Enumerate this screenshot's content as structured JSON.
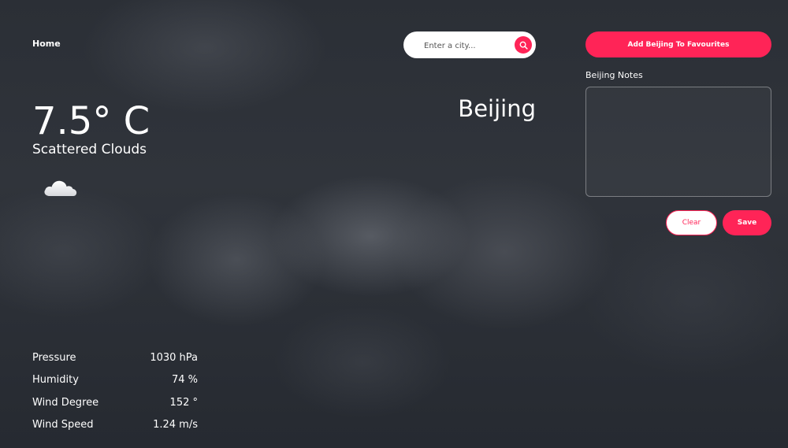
{
  "nav": {
    "home_label": "Home"
  },
  "search": {
    "placeholder": "Enter a city...",
    "value": "",
    "button_icon": "search-icon"
  },
  "city": {
    "name": "Beijing"
  },
  "weather": {
    "temperature": "7.5° C",
    "description": "Scattered Clouds",
    "icon": "cloud-icon"
  },
  "stats": [
    {
      "label": "Pressure",
      "value": "1030 hPa"
    },
    {
      "label": "Humidity",
      "value": "74 %"
    },
    {
      "label": "Wind Degree",
      "value": "152 °"
    },
    {
      "label": "Wind Speed",
      "value": "1.24 m/s"
    }
  ],
  "favourites": {
    "button_label": "Add Beijing To Favourites"
  },
  "notes": {
    "label": "Beijing Notes",
    "value": "",
    "clear_label": "Clear",
    "save_label": "Save"
  },
  "colors": {
    "accent": "#ff2457",
    "text": "#ffffff",
    "background": "#2b2f36"
  }
}
